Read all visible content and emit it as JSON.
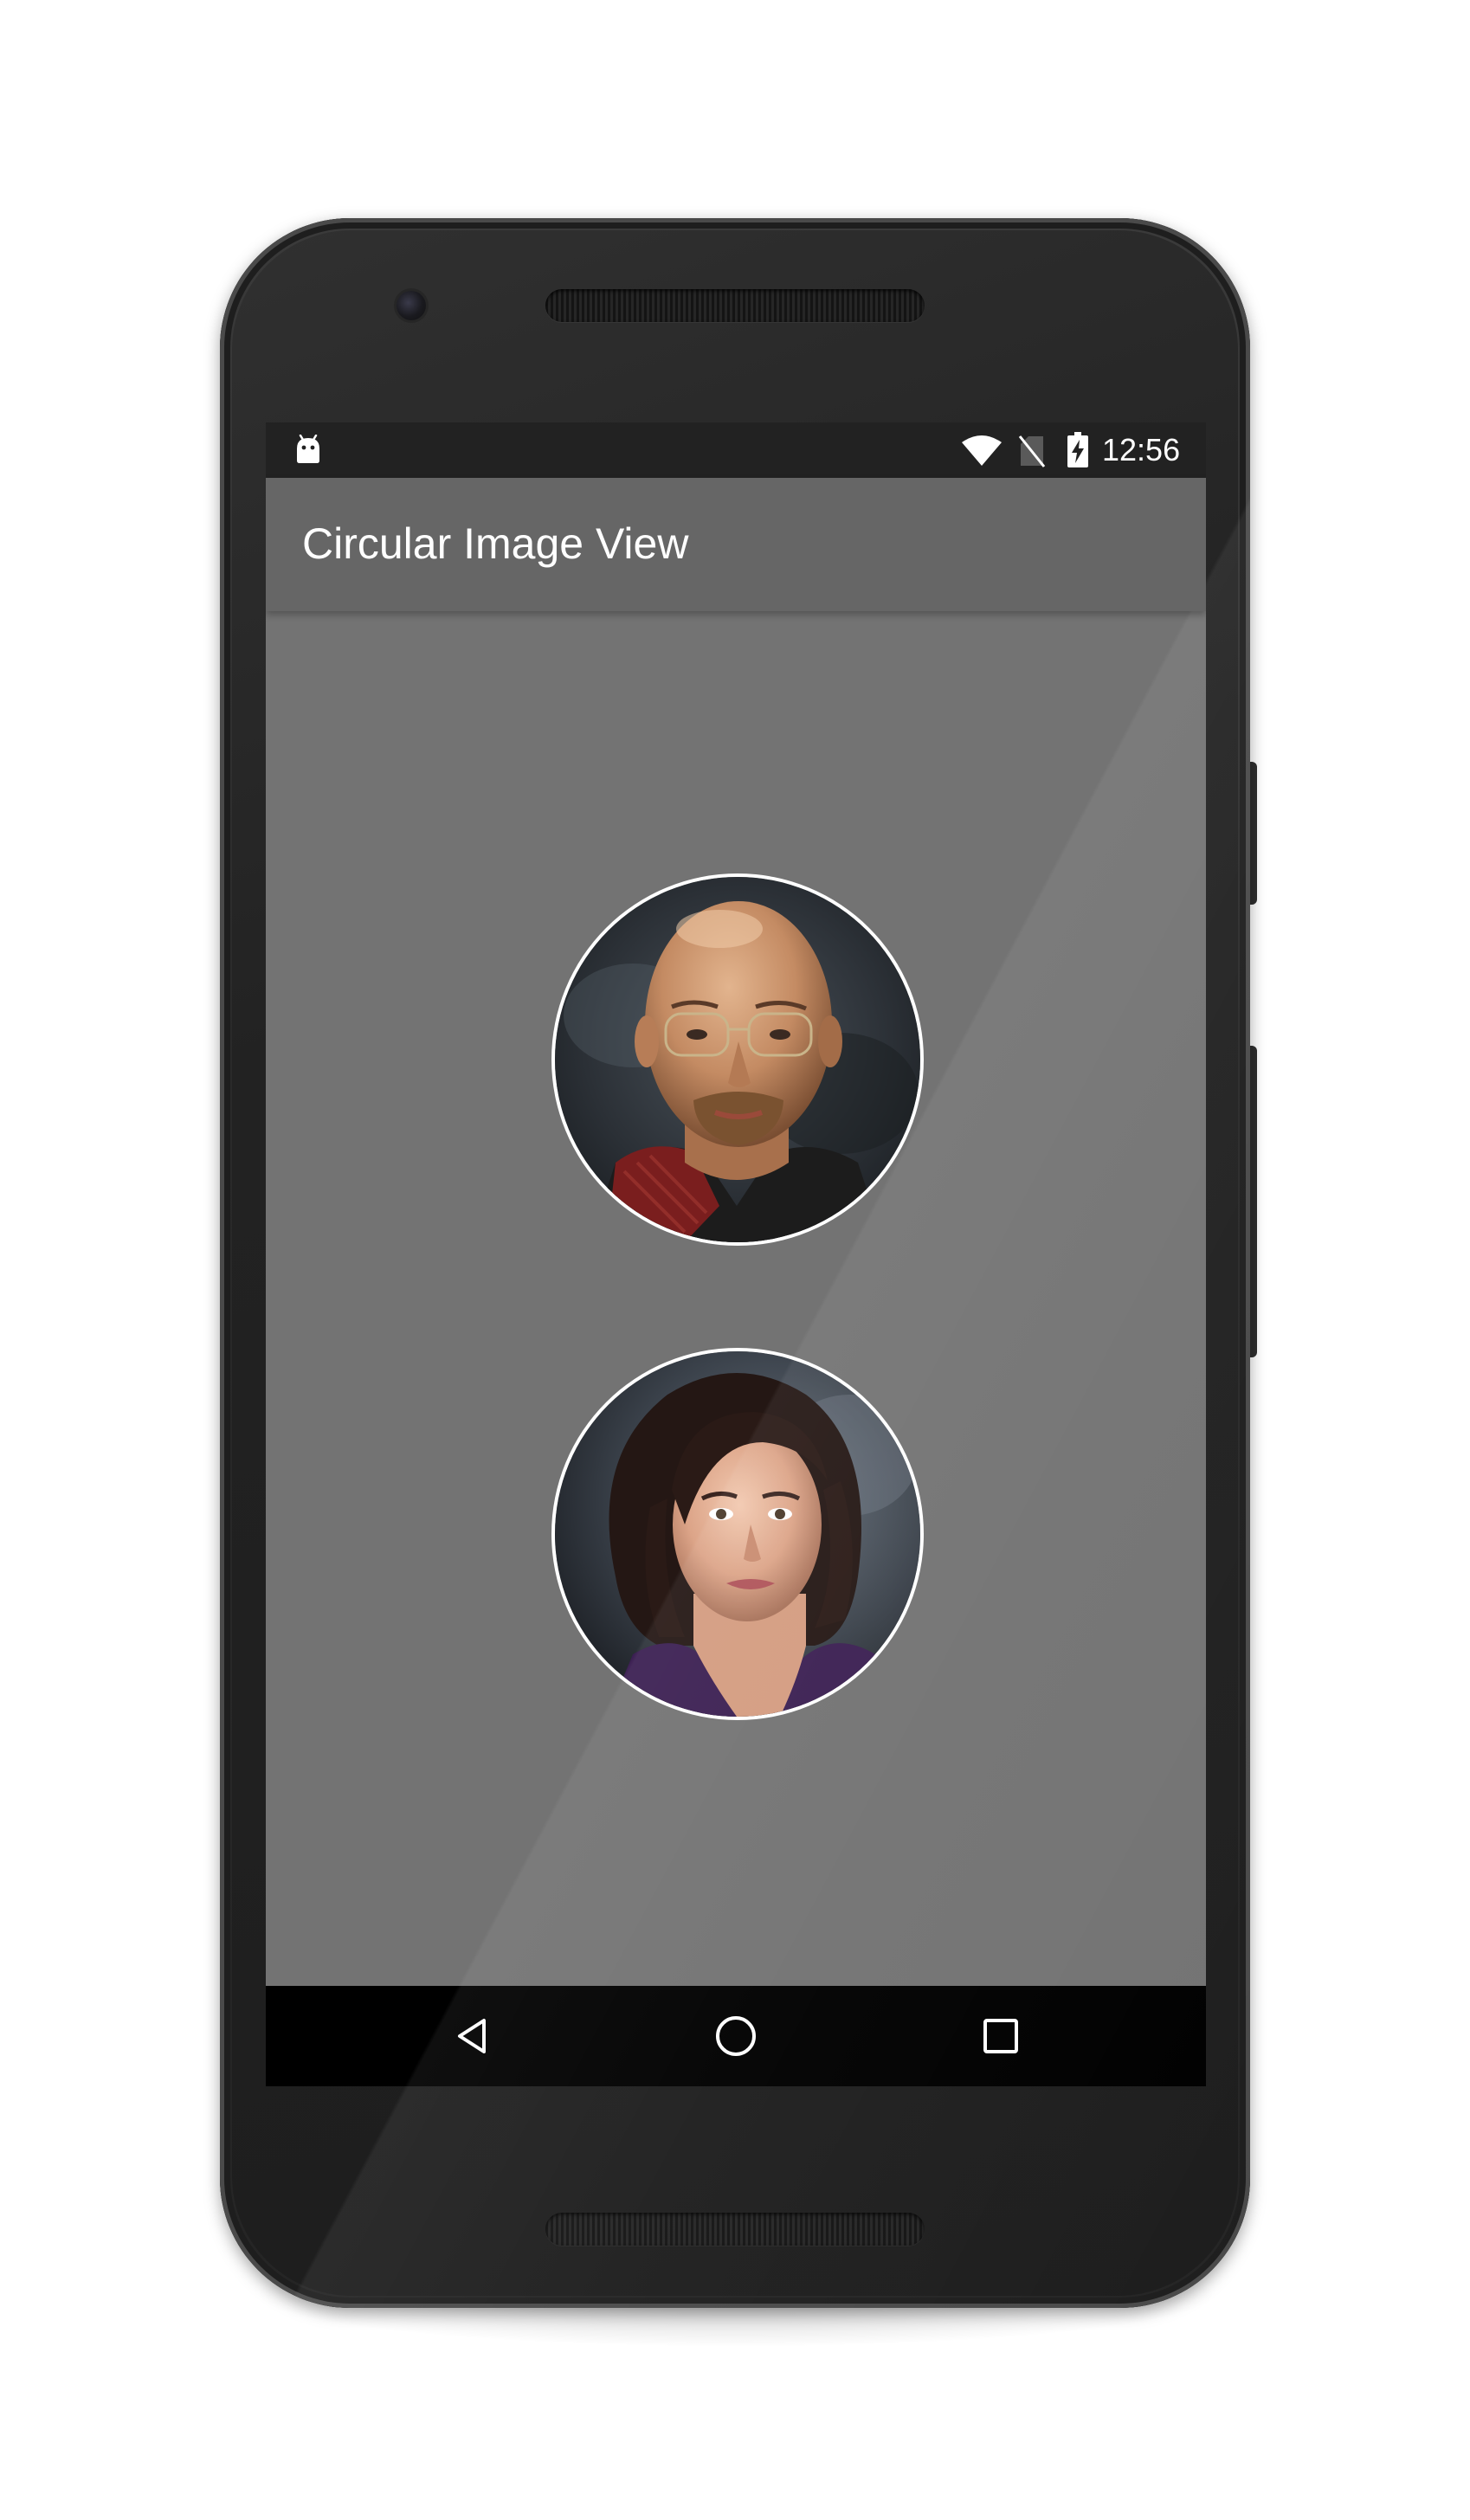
{
  "status_bar": {
    "time": "12:56",
    "icons": [
      "android-debug-icon",
      "wifi-icon",
      "no-sim-icon",
      "battery-charging-icon"
    ]
  },
  "app_bar": {
    "title": "Circular Image View"
  },
  "content": {
    "images": [
      {
        "name": "bald-man-portrait",
        "shape": "circle",
        "border_color": "#ffffff"
      },
      {
        "name": "dark-haired-woman-portrait",
        "shape": "circle",
        "border_color": "#ffffff"
      }
    ]
  },
  "nav_bar": {
    "buttons": [
      "back-icon",
      "home-icon",
      "recents-icon"
    ]
  },
  "colors": {
    "status_bar": "#222222",
    "app_bar": "#666666",
    "content_background": "#737373",
    "nav_bar": "#000000",
    "text": "#ffffff"
  }
}
